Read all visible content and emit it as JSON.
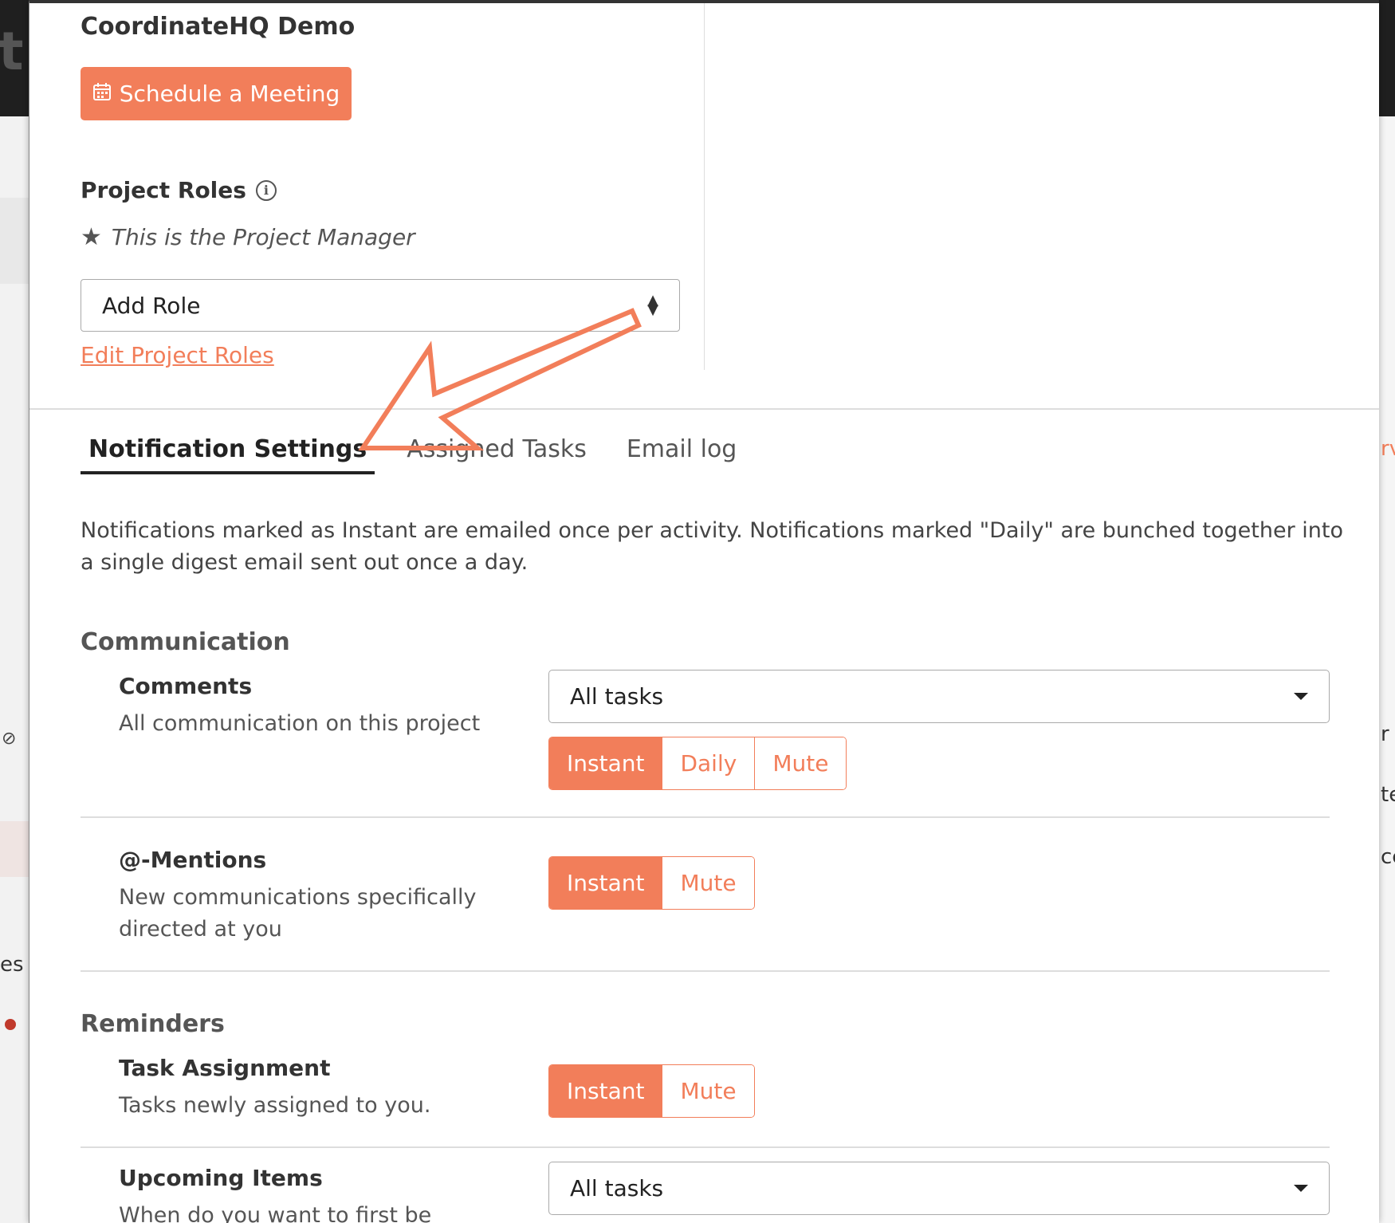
{
  "background": {
    "left_fragment": "t",
    "left_text": "es",
    "right_fragments": [
      "rv",
      "r",
      "te",
      "cc"
    ]
  },
  "header": {
    "project_title": "CoordinateHQ Demo",
    "schedule_button": "Schedule a Meeting"
  },
  "roles": {
    "heading": "Project Roles",
    "manager_note": "This is the Project Manager",
    "add_role_select": "Add Role",
    "edit_link": "Edit Project Roles"
  },
  "tabs": [
    {
      "label": "Notification Settings",
      "active": true
    },
    {
      "label": "Assigned Tasks",
      "active": false
    },
    {
      "label": "Email log",
      "active": false
    }
  ],
  "intro": "Notifications marked as Instant are emailed once per activity. Notifications marked \"Daily\" are bunched together into a single digest email sent out once a day.",
  "communication": {
    "heading": "Communication",
    "comments": {
      "title": "Comments",
      "desc": "All communication on this project",
      "scope": "All tasks",
      "options": [
        "Instant",
        "Daily",
        "Mute"
      ],
      "selected": "Instant"
    },
    "mentions": {
      "title": "@-Mentions",
      "desc": "New communications specifically directed at you",
      "options": [
        "Instant",
        "Mute"
      ],
      "selected": "Instant"
    }
  },
  "reminders": {
    "heading": "Reminders",
    "task_assignment": {
      "title": "Task Assignment",
      "desc": "Tasks newly assigned to you.",
      "options": [
        "Instant",
        "Mute"
      ],
      "selected": "Instant"
    },
    "upcoming": {
      "title": "Upcoming Items",
      "desc": "When do you want to first be notified",
      "scope": "All tasks"
    }
  },
  "colors": {
    "accent": "#f27e5a",
    "text_dark": "#333333",
    "annotation_arrow": "#f27e5a"
  },
  "icons": {
    "calendar": "calendar-icon",
    "info": "info-icon",
    "star": "star-icon",
    "select_arrows": "sort-arrows-icon",
    "dropdown": "caret-down-icon"
  }
}
